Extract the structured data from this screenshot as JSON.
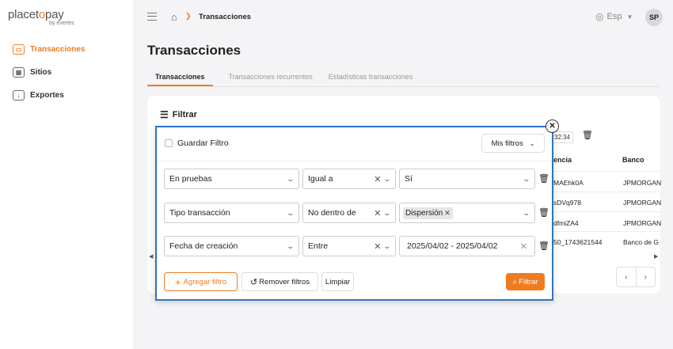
{
  "brand": {
    "name_pre": "placet",
    "name_o": "o",
    "name_post": "pay",
    "sub": "by evertec"
  },
  "sidebar": {
    "items": [
      {
        "label": "Transacciones",
        "icon": "card-icon"
      },
      {
        "label": "Sitios",
        "icon": "grid-icon"
      },
      {
        "label": "Exportes",
        "icon": "export-icon"
      }
    ]
  },
  "header": {
    "breadcrumb": "Transacciones",
    "language": "Esp",
    "avatar": "SP"
  },
  "page": {
    "title": "Transacciones",
    "tabs": [
      "Transacciones",
      "Transacciones recurrentes",
      "Estadísticas transacciones"
    ]
  },
  "filter_panel": {
    "title": "Filtrar",
    "save_filter_label": "Guardar Filtro",
    "my_filters_label": "Mis filtros",
    "rows": [
      {
        "field": "En pruebas",
        "operator": "Igual a",
        "value": "Sí"
      },
      {
        "field": "Tipo transacción",
        "operator": "No dentro de",
        "value_chip": "Dispersión"
      },
      {
        "field": "Fecha de creación",
        "operator": "Entre",
        "value": "2025/04/02 - 2025/04/02"
      }
    ],
    "add_filter_label": "Agregar filtro",
    "remove_filters_label": "Remover filtros",
    "clear_label": "Limpiar",
    "apply_label": "Filtrar"
  },
  "table_peek": {
    "time": "32:34",
    "columns": [
      "encia",
      "Banco"
    ],
    "rows": [
      {
        "ref": "MAEhk0A",
        "bank": "JPMORGAN"
      },
      {
        "ref": "sDVq978",
        "bank": "JPMORGAN"
      },
      {
        "ref": "dfmiZA4",
        "bank": "JPMORGAN"
      },
      {
        "ref": "50_1743621544",
        "bank": "Banco de G"
      }
    ]
  },
  "colors": {
    "accent": "#f07c21",
    "modal_border": "#2f74c0"
  }
}
